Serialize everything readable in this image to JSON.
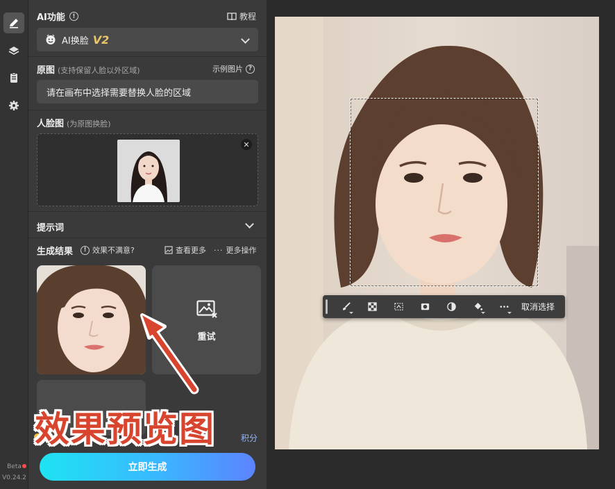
{
  "sidebar": {
    "tools": [
      {
        "name": "edit-icon",
        "active": true
      },
      {
        "name": "layers-icon",
        "active": false
      },
      {
        "name": "clipboard-icon",
        "active": false
      },
      {
        "name": "gear-icon",
        "active": false
      }
    ],
    "beta_label": "Beta",
    "version": "V0.24.2"
  },
  "panel": {
    "ai_feature_label": "AI功能",
    "tutorial_label": "教程",
    "feature_select": {
      "icon": "face-icon",
      "label": "AI换脸",
      "version": "V2"
    },
    "source": {
      "label": "原图",
      "note": "(支持保留人脸以外区域)",
      "example_label": "示例图片",
      "placeholder": "请在画布中选择需要替换人脸的区域"
    },
    "face": {
      "label": "人脸图",
      "note": "(为原图换脸)",
      "remove_icon": "close-icon"
    },
    "prompt": {
      "label": "提示词"
    },
    "results": {
      "label": "生成结果",
      "feedback_label": "效果不满意?",
      "view_more_label": "查看更多",
      "more_actions_label": "更多操作",
      "retry_label": "重试",
      "credits_suffix": "积分"
    },
    "generate_button": "立即生成"
  },
  "canvas": {
    "toolbar": {
      "tools": [
        "brush-icon",
        "checker-select-icon",
        "marquee-icon",
        "mask-icon",
        "contrast-icon",
        "bucket-icon",
        "more-icon"
      ],
      "cancel_selection": "取消选择"
    }
  },
  "annotation": {
    "text": "效果预览图",
    "color": "#d7452f"
  },
  "colors": {
    "panel_bg": "#3a3a3a",
    "field_bg": "#4a4a4a",
    "accent_gradient_start": "#1fe3f2",
    "accent_gradient_end": "#5c83ff",
    "version_badge": "#e8c46a"
  }
}
